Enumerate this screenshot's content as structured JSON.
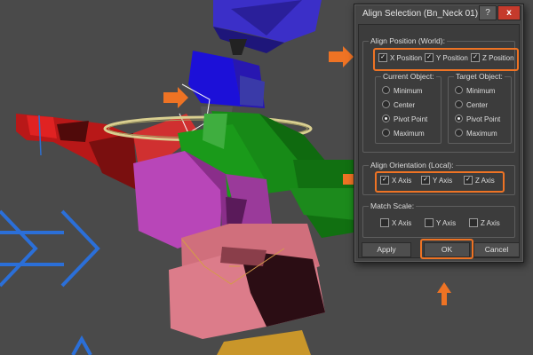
{
  "dialog": {
    "title": "Align Selection (Bn_Neck 01)",
    "help_label": "?",
    "close_label": "x",
    "align_position": {
      "label": "Align Position (World):",
      "x_label": "X Position",
      "y_label": "Y Position",
      "z_label": "Z Position",
      "checked": [
        true,
        true,
        true
      ]
    },
    "current_object": {
      "label": "Current Object:",
      "options": [
        "Minimum",
        "Center",
        "Pivot Point",
        "Maximum"
      ],
      "selected": "Pivot Point"
    },
    "target_object": {
      "label": "Target Object:",
      "options": [
        "Minimum",
        "Center",
        "Pivot Point",
        "Maximum"
      ],
      "selected": "Pivot Point"
    },
    "align_orientation": {
      "label": "Align Orientation (Local):",
      "x_label": "X Axis",
      "y_label": "Y Axis",
      "z_label": "Z Axis",
      "checked": [
        true,
        true,
        true
      ]
    },
    "match_scale": {
      "label": "Match Scale:",
      "x_label": "X Axis",
      "y_label": "Y Axis",
      "z_label": "Z Axis",
      "checked": [
        false,
        false,
        false
      ]
    },
    "buttons": {
      "apply": "Apply",
      "ok": "OK",
      "cancel": "Cancel"
    }
  },
  "colors": {
    "highlight": "#ee7324",
    "viewport_bg": "#4a4a4a",
    "close_button": "#c53a2c"
  },
  "icons": [
    "right-arrow-icon",
    "up-arrow-icon",
    "check-icon"
  ]
}
